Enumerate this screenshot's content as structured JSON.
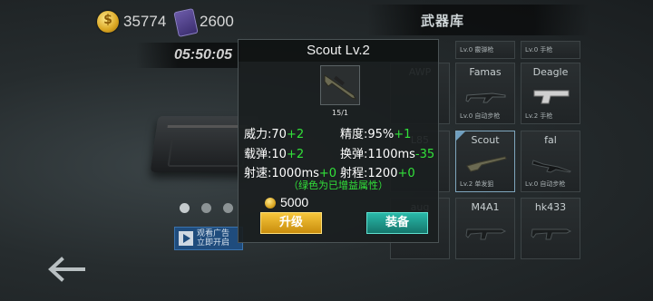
{
  "currency": {
    "gold": "35774",
    "gems": "2600"
  },
  "arsenal_title": "武器库",
  "timer": "05:50:05",
  "ad_button": {
    "line1": "观看广告",
    "line2": "立即开启"
  },
  "carousel": {
    "page_count": 3,
    "active_index": 0
  },
  "popup": {
    "title": "Scout Lv.2",
    "ammo": "15/1",
    "stats": {
      "power_label": "威力:70",
      "power_bonus": "+2",
      "accuracy_label": "精度:95%",
      "accuracy_bonus": "+1",
      "magazine_label": "载弹:10",
      "magazine_bonus": "+2",
      "reload_label": "换弹:1100ms",
      "reload_bonus": "-35",
      "firerate_label": "射速:1000ms",
      "firerate_bonus": "+0",
      "range_label": "射程:1200",
      "range_bonus": "+0"
    },
    "bonus_note": "（绿色为已增益属性）",
    "cost": "5000",
    "upgrade_label": "升级",
    "equip_label": "装备"
  },
  "weapon_grid": {
    "top_row": [
      {
        "level": "Lv.0",
        "type": "霰弹枪"
      },
      {
        "level": "Lv.0",
        "type": "手枪"
      }
    ],
    "row1": [
      {
        "name": "AWP",
        "level": "",
        "type": ""
      },
      {
        "name": "Famas",
        "level": "Lv.0",
        "type": "自动步枪"
      },
      {
        "name": "Deagle",
        "level": "Lv.2",
        "type": "手枪"
      }
    ],
    "row2": [
      {
        "name": "L85",
        "level": "",
        "type": ""
      },
      {
        "name": "Scout",
        "level": "Lv.2",
        "type": "单发狙"
      },
      {
        "name": "fal",
        "level": "Lv.0",
        "type": "自动步枪"
      }
    ],
    "row3": [
      {
        "name": "aug",
        "level": "",
        "type": ""
      },
      {
        "name": "M4A1",
        "level": "",
        "type": ""
      },
      {
        "name": "hk433",
        "level": "",
        "type": ""
      }
    ]
  },
  "colors": {
    "bonus_green": "#32e23a",
    "upgrade_gold": "#f6c63b",
    "equip_teal": "#29b9a9"
  }
}
